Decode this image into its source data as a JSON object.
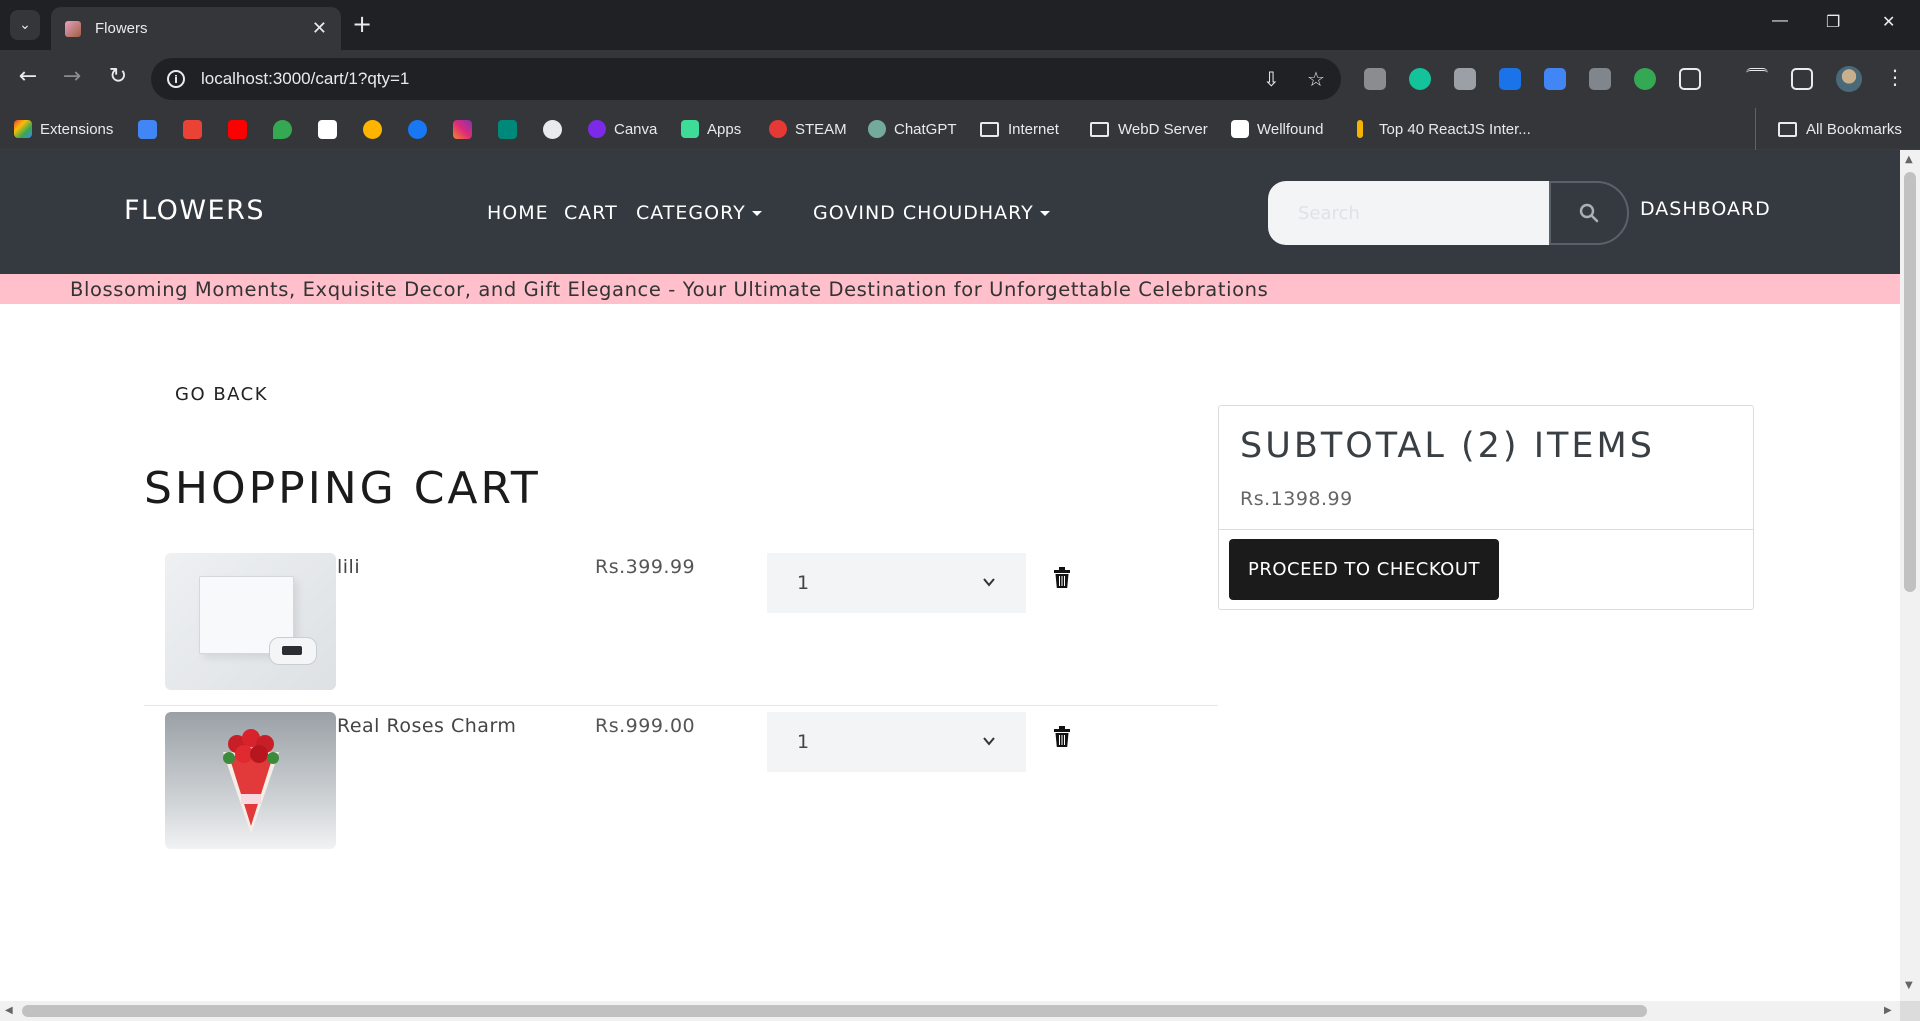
{
  "browser": {
    "tab_title": "Flowers",
    "url": "localhost:3000/cart/1?qty=1",
    "bookmarks": [
      {
        "label": "Extensions"
      },
      {
        "label": "Canva"
      },
      {
        "label": "Apps"
      },
      {
        "label": "STEAM"
      },
      {
        "label": "ChatGPT"
      },
      {
        "label": "Internet"
      },
      {
        "label": "WebD Server"
      },
      {
        "label": "Wellfound"
      },
      {
        "label": "Top 40 ReactJS Inter..."
      },
      {
        "label": "All Bookmarks"
      }
    ]
  },
  "site": {
    "brand": "FLOWERS",
    "nav": {
      "home": "HOME",
      "cart": "CART",
      "category": "CATEGORY",
      "user": "GOVIND CHOUDHARY",
      "dashboard": "DASHBOARD"
    },
    "search_placeholder": "Search",
    "tagline": "Blossoming Moments, Exquisite Decor, and Gift Elegance - Your Ultimate Destination for Unforgettable Celebrations"
  },
  "cart": {
    "go_back": "GO BACK",
    "title": "SHOPPING CART",
    "items": [
      {
        "name": "lili",
        "price": "Rs.399.99",
        "qty": "1"
      },
      {
        "name": "Real Roses Charm",
        "price": "Rs.999.00",
        "qty": "1"
      }
    ]
  },
  "summary": {
    "title": "SUBTOTAL (2) ITEMS",
    "total": "Rs.1398.99",
    "checkout_label": "PROCEED TO CHECKOUT"
  },
  "colors": {
    "navbar_bg": "#343a40",
    "marquee_bg": "#ffc0cb",
    "checkout_bg": "#1b1b1b"
  }
}
